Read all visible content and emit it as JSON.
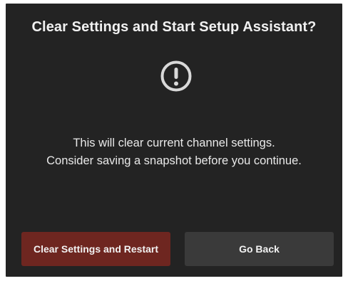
{
  "dialog": {
    "title": "Clear Settings and Start Setup Assistant?",
    "icon": "exclamation-circle-icon",
    "message_lines": [
      "This will clear current channel settings.",
      "Consider saving a snapshot before you continue."
    ],
    "buttons": {
      "clear_label": "Clear Settings and Restart",
      "back_label": "Go Back"
    }
  },
  "colors": {
    "dialog_background": "#232323",
    "clear_button": "#6e2620",
    "back_button": "#3a3a3a",
    "text": "#f1f1f1",
    "icon": "#d9d9d9"
  }
}
